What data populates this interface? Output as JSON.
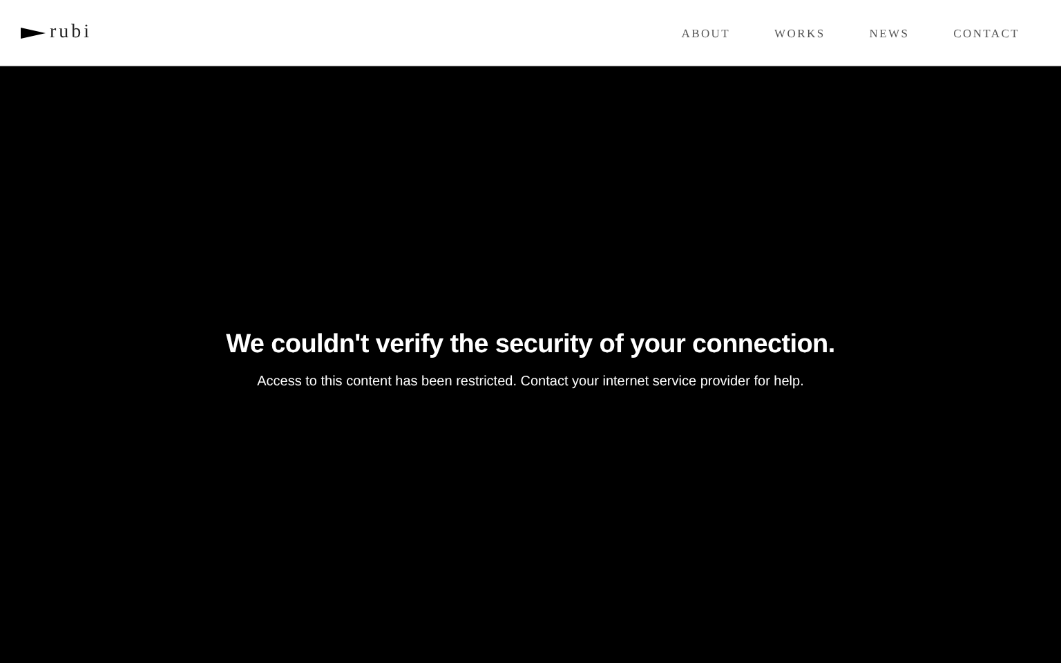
{
  "header": {
    "logo": "rubi",
    "nav": [
      "ABOUT",
      "WORKS",
      "NEWS",
      "CONTACT"
    ]
  },
  "message": {
    "title": "We couldn't verify the security of your connection.",
    "body": "Access to this content has been restricted. Contact your internet service provider for help."
  }
}
